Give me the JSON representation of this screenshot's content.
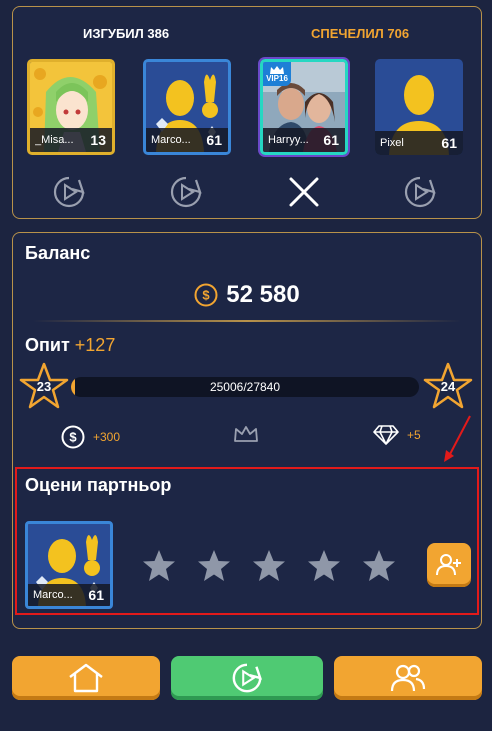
{
  "teams": {
    "lost_title": "ИЗГУБИЛ 386",
    "won_title": "СПЕЧЕЛИЛ 706"
  },
  "players": [
    {
      "name": "_Misa...",
      "level": "13",
      "avatar": "anime-girl-avatar",
      "frame": "gold"
    },
    {
      "name": "Marco...",
      "level": "61",
      "avatar": "default-silhouette-avatar",
      "frame": "gold-diamond"
    },
    {
      "name": "Harryy...",
      "level": "61",
      "avatar": "photo-couple-avatar",
      "frame": "vip",
      "badge": "VIP16"
    },
    {
      "name": "Pixel",
      "level": "61",
      "avatar": "default-silhouette-avatar",
      "frame": "none"
    }
  ],
  "player_actions": [
    "replay-icon",
    "replay-icon",
    "close-icon",
    "replay-icon"
  ],
  "balance": {
    "label": "Баланс",
    "value": "52 580",
    "icon": "coin-icon"
  },
  "experience": {
    "label": "Опит",
    "gain": "+127",
    "current_level": "23",
    "next_level": "24",
    "progress_text": "25006/27840",
    "progress_fraction": 0.0
  },
  "rewards": {
    "coins": "+300",
    "gems": "+5",
    "icons": [
      "coin-icon",
      "crown-icon",
      "diamond-icon"
    ]
  },
  "rating": {
    "label": "Оцени партньор",
    "partner_name": "Marco...",
    "partner_level": "61",
    "stars": 0,
    "max_stars": 5
  },
  "nav": {
    "icons": [
      "home-icon",
      "replay-icon",
      "friends-icon"
    ]
  },
  "colors": {
    "accent": "#f2a531",
    "green": "#4fca73",
    "panel": "#1d2645",
    "border": "#b8924a",
    "highlight": "#e21a1a"
  }
}
